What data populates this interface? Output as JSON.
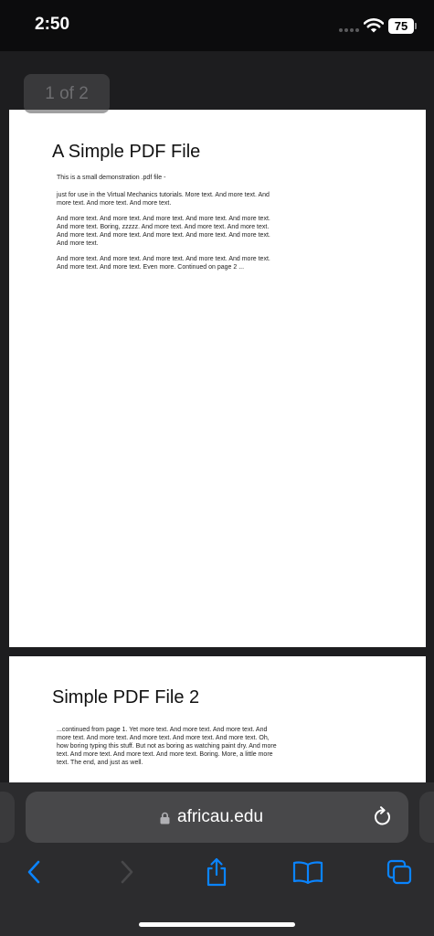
{
  "status_bar": {
    "time": "2:50",
    "battery_level": "75"
  },
  "viewer": {
    "page_counter": "1 of 2",
    "pages": [
      {
        "title": "A Simple PDF File",
        "paragraphs": [
          "This is a small demonstration .pdf file -",
          "just for use in the Virtual Mechanics tutorials. More text. And more text. And more text. And more text. And more text.",
          "And more text. And more text. And more text. And more text. And more text. And more text. Boring, zzzzz. And more text. And more text. And more text. And more text. And more text. And more text. And more text. And more text. And more text.",
          "And more text. And more text. And more text. And more text. And more text. And more text. And more text. Even more. Continued on page 2 ..."
        ]
      },
      {
        "title": "Simple PDF File 2",
        "paragraphs": [
          "...continued from page 1. Yet more text. And more text. And more text. And more text. And more text. And more text. And more text. And more text. Oh, how boring typing this stuff. But not as boring as watching paint dry. And more text. And more text. And more text. And more text. Boring.  More, a little more text. The end, and just as well."
        ]
      }
    ]
  },
  "toolbar": {
    "url": "africau.edu",
    "accent_color": "#0a84ff",
    "icons": {
      "lock": "lock-icon",
      "reload": "reload-icon",
      "back": "chevron-left-icon",
      "forward": "chevron-right-icon",
      "share": "share-icon",
      "bookmarks": "book-icon",
      "tabs": "tabs-icon"
    }
  }
}
